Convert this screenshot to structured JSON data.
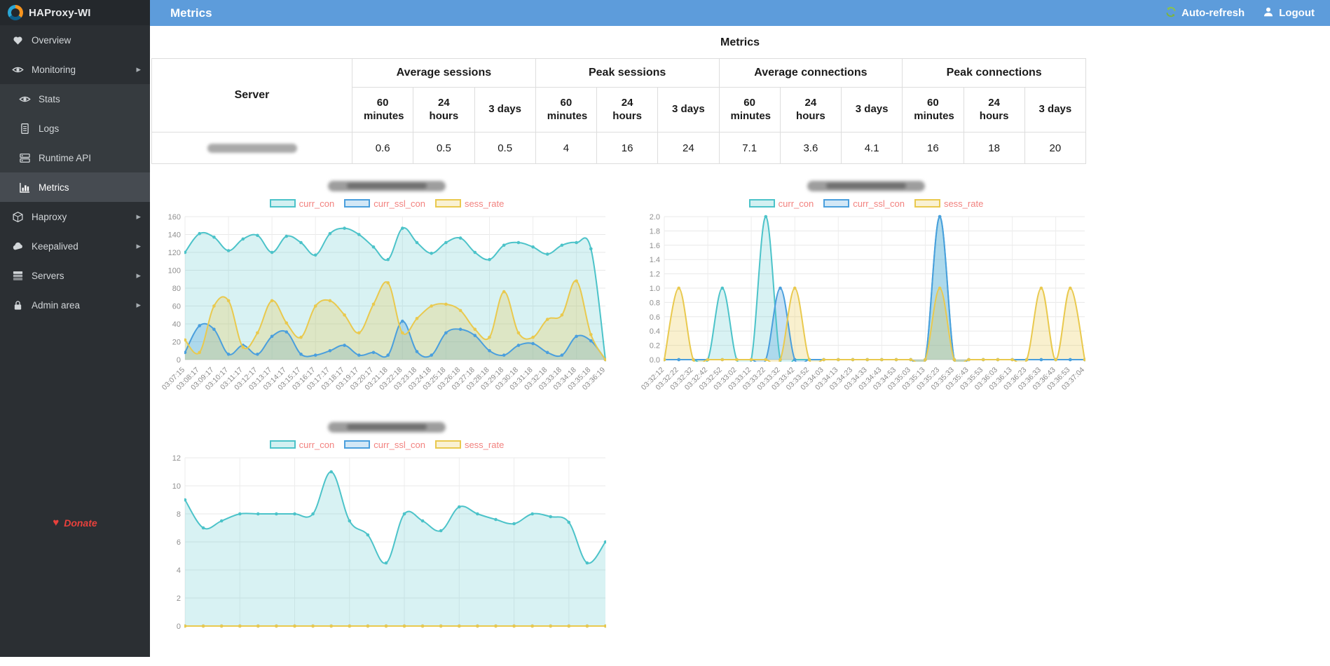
{
  "app": {
    "title": "HAProxy-WI"
  },
  "header": {
    "title": "Metrics",
    "auto_refresh_label": "Auto-refresh",
    "logout_label": "Logout"
  },
  "sidebar": {
    "items": [
      {
        "label": "Overview",
        "icon": "heartbeat-icon",
        "type": "top"
      },
      {
        "label": "Monitoring",
        "icon": "eye-icon",
        "type": "top",
        "expandable": true
      },
      {
        "label": "Stats",
        "icon": "eye-icon",
        "type": "sub"
      },
      {
        "label": "Logs",
        "icon": "document-icon",
        "type": "sub"
      },
      {
        "label": "Runtime API",
        "icon": "runtime-icon",
        "type": "sub"
      },
      {
        "label": "Metrics",
        "icon": "chart-icon",
        "type": "sub",
        "active": true
      },
      {
        "label": "Haproxy",
        "icon": "cube-icon",
        "type": "top",
        "expandable": true
      },
      {
        "label": "Keepalived",
        "icon": "cloud-icon",
        "type": "top",
        "expandable": true
      },
      {
        "label": "Servers",
        "icon": "servers-icon",
        "type": "top",
        "expandable": true
      },
      {
        "label": "Admin area",
        "icon": "lock-icon",
        "type": "top",
        "expandable": true
      }
    ],
    "donate_label": "Donate"
  },
  "page": {
    "title": "Metrics"
  },
  "metrics_table": {
    "server_header": "Server",
    "groups": [
      "Average sessions",
      "Peak sessions",
      "Average connections",
      "Peak connections"
    ],
    "period_headers": [
      "60 minutes",
      "24 hours",
      "3 days"
    ],
    "rows": [
      {
        "server_redacted": true,
        "values": [
          "0.6",
          "0.5",
          "0.5",
          "4",
          "16",
          "24",
          "7.1",
          "3.6",
          "4.1",
          "16",
          "18",
          "20"
        ]
      }
    ]
  },
  "ui": {
    "accent_blue": "#5d9cdb",
    "sidebar_bg": "#2b2f33",
    "legend_text_color": "#f2827f",
    "donate_color": "#e8413c",
    "autorefresh_green": "#7cb342",
    "grid_color": "#e8e8e8",
    "axis_label_color": "#8f8f8f"
  },
  "chart_data": [
    {
      "type": "area",
      "title_redacted": true,
      "ymin": 0,
      "ymax": 160,
      "ystep": 20,
      "legend_position": "top",
      "x_labels": [
        "03:07:15",
        "03:08:17",
        "03:09:17",
        "03:10:17",
        "03:11:17",
        "03:12:17",
        "03:13:17",
        "03:14:17",
        "03:15:17",
        "03:16:17",
        "03:17:17",
        "03:18:17",
        "03:19:17",
        "03:20:17",
        "03:21:18",
        "03:22:18",
        "03:23:18",
        "03:24:18",
        "03:25:18",
        "03:26:18",
        "03:27:18",
        "03:28:18",
        "03:29:18",
        "03:30:18",
        "03:31:18",
        "03:32:18",
        "03:33:18",
        "03:34:18",
        "03:35:18",
        "03:36:19"
      ],
      "series": [
        {
          "name": "curr_con",
          "color": "#4cc3c9",
          "fill_opacity": 0.22,
          "values": [
            120,
            141,
            137,
            122,
            135,
            139,
            120,
            138,
            131,
            117,
            141,
            147,
            140,
            126,
            112,
            147,
            131,
            119,
            131,
            136,
            120,
            112,
            128,
            131,
            126,
            118,
            128,
            131,
            124,
            0
          ]
        },
        {
          "name": "curr_ssl_con",
          "color": "#4a9fdd",
          "fill_opacity": 0.3,
          "values": [
            8,
            38,
            34,
            6,
            16,
            6,
            26,
            31,
            6,
            5,
            10,
            16,
            5,
            8,
            5,
            43,
            9,
            5,
            30,
            34,
            27,
            10,
            5,
            16,
            18,
            8,
            5,
            26,
            21,
            0
          ]
        },
        {
          "name": "sess_rate",
          "color": "#e9c94e",
          "fill_opacity": 0.28,
          "values": [
            22,
            8,
            60,
            66,
            14,
            30,
            66,
            41,
            25,
            60,
            66,
            50,
            30,
            62,
            86,
            30,
            46,
            60,
            62,
            55,
            34,
            25,
            76,
            30,
            25,
            45,
            50,
            88,
            28,
            0
          ]
        }
      ]
    },
    {
      "type": "area",
      "title_redacted": true,
      "ymin": 0,
      "ymax": 2.0,
      "ystep": 0.2,
      "legend_position": "top",
      "x_labels": [
        "03:32:12",
        "03:32:22",
        "03:32:32",
        "03:32:42",
        "03:32:52",
        "03:33:02",
        "03:33:12",
        "03:33:22",
        "03:33:32",
        "03:33:42",
        "03:33:52",
        "03:34:03",
        "03:34:13",
        "03:34:23",
        "03:34:33",
        "03:34:43",
        "03:34:53",
        "03:35:03",
        "03:35:13",
        "03:35:23",
        "03:35:33",
        "03:35:43",
        "03:35:53",
        "03:36:03",
        "03:36:13",
        "03:36:23",
        "03:36:33",
        "03:36:43",
        "03:36:53",
        "03:37:04"
      ],
      "series": [
        {
          "name": "curr_con",
          "color": "#4cc3c9",
          "fill_opacity": 0.22,
          "values": [
            0,
            0,
            0,
            0,
            1,
            0,
            0,
            2,
            0,
            0,
            0,
            0,
            0,
            0,
            0,
            0,
            0,
            0,
            0,
            2,
            0,
            0,
            0,
            0,
            0,
            0,
            0,
            0,
            0,
            0
          ]
        },
        {
          "name": "curr_ssl_con",
          "color": "#4a9fdd",
          "fill_opacity": 0.3,
          "values": [
            0,
            0,
            0,
            0,
            0,
            0,
            0,
            0,
            1,
            0,
            0,
            0,
            0,
            0,
            0,
            0,
            0,
            0,
            0,
            2,
            0,
            0,
            0,
            0,
            0,
            0,
            0,
            0,
            0,
            0
          ]
        },
        {
          "name": "sess_rate",
          "color": "#e9c94e",
          "fill_opacity": 0.28,
          "values": [
            0,
            1,
            0,
            0,
            0,
            0,
            0,
            0,
            0,
            1,
            0,
            0,
            0,
            0,
            0,
            0,
            0,
            0,
            0,
            1,
            0,
            0,
            0,
            0,
            0,
            0,
            1,
            0,
            1,
            0
          ]
        }
      ]
    },
    {
      "type": "area",
      "title_redacted": true,
      "ymin": 0,
      "ymax": 12,
      "ystep": 2,
      "legend_position": "top",
      "x_labels": [],
      "series": [
        {
          "name": "curr_con",
          "color": "#4cc3c9",
          "fill_opacity": 0.22,
          "values": [
            9,
            7,
            7.5,
            8,
            8,
            8,
            8,
            8,
            11,
            7.5,
            6.5,
            4.5,
            8,
            7.5,
            6.8,
            8.5,
            8,
            7.6,
            7.3,
            8,
            7.8,
            7.4,
            4.5,
            6
          ]
        },
        {
          "name": "curr_ssl_con",
          "color": "#4a9fdd",
          "fill_opacity": 0.3,
          "values": [
            0,
            0,
            0,
            0,
            0,
            0,
            0,
            0,
            0,
            0,
            0,
            0,
            0,
            0,
            0,
            0,
            0,
            0,
            0,
            0,
            0,
            0,
            0,
            0
          ]
        },
        {
          "name": "sess_rate",
          "color": "#e9c94e",
          "fill_opacity": 0.28,
          "values": [
            0,
            0,
            0,
            0,
            0,
            0,
            0,
            0,
            0,
            0,
            0,
            0,
            0,
            0,
            0,
            0,
            0,
            0,
            0,
            0,
            0,
            0,
            0,
            0
          ]
        }
      ]
    }
  ]
}
